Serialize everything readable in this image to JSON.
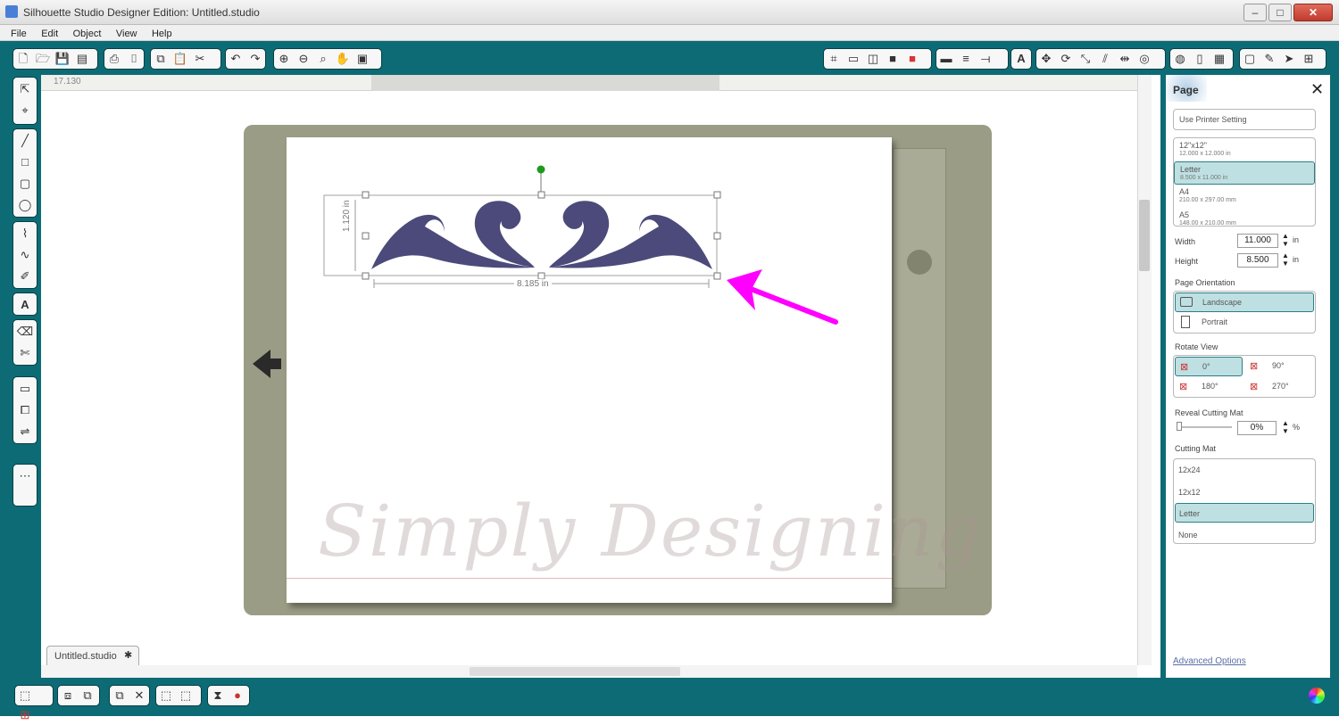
{
  "window": {
    "title": "Silhouette Studio Designer Edition: Untitled.studio",
    "min_glyph": "–",
    "max_glyph": "□",
    "close_glyph": "✕"
  },
  "menu": [
    "File",
    "Edit",
    "Object",
    "View",
    "Help"
  ],
  "canvas": {
    "ruler_readout": "17.130",
    "selection_width_label": "8.185 in",
    "selection_height_label": "1.120 in",
    "watermark": "Simply Designing",
    "document_tab": "Untitled.studio",
    "document_tab_close": "✱"
  },
  "colors": {
    "frame": "#0d6b75",
    "design_fill": "#4b4a7a",
    "arrow": "#ff00ff",
    "mat": "#9b9c85",
    "selected_item": "#bfe0e2"
  },
  "panel": {
    "title": "Page",
    "close_glyph": "✕",
    "printer_setting": "Use Printer Setting",
    "sizes": [
      {
        "name": "12\"x12\"",
        "dims": "12.000 x 12.000 in"
      },
      {
        "name": "Letter",
        "dims": "8.500 x 11.000 in"
      },
      {
        "name": "A4",
        "dims": "210.00 x 297.00 mm"
      },
      {
        "name": "A5",
        "dims": "148.00 x 210.00 mm"
      }
    ],
    "width_label": "Width",
    "width_value": "11.000",
    "height_label": "Height",
    "height_value": "8.500",
    "unit": "in",
    "orientation_label": "Page Orientation",
    "orientation_landscape": "Landscape",
    "orientation_portrait": "Portrait",
    "rotate_label": "Rotate View",
    "rotate_options": [
      "0°",
      "90°",
      "180°",
      "270°"
    ],
    "reveal_label": "Reveal Cutting Mat",
    "reveal_value": "0%",
    "reveal_unit": "%",
    "mat_label": "Cutting Mat",
    "mat_options": [
      "12x24",
      "12x12",
      "Letter",
      "None"
    ],
    "advanced": "Advanced Options"
  }
}
